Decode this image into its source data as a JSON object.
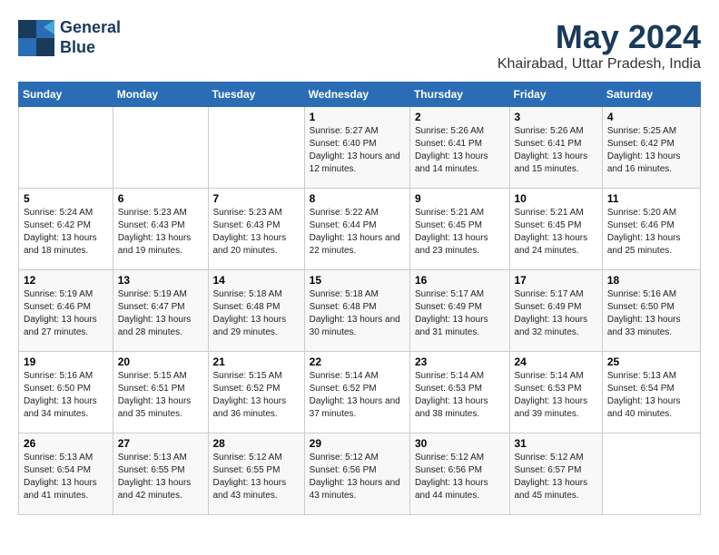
{
  "header": {
    "logo_line1": "General",
    "logo_line2": "Blue",
    "title": "May 2024",
    "subtitle": "Khairabad, Uttar Pradesh, India"
  },
  "weekdays": [
    "Sunday",
    "Monday",
    "Tuesday",
    "Wednesday",
    "Thursday",
    "Friday",
    "Saturday"
  ],
  "weeks": [
    [
      {
        "day": "",
        "sunrise": "",
        "sunset": "",
        "daylight": ""
      },
      {
        "day": "",
        "sunrise": "",
        "sunset": "",
        "daylight": ""
      },
      {
        "day": "",
        "sunrise": "",
        "sunset": "",
        "daylight": ""
      },
      {
        "day": "1",
        "sunrise": "Sunrise: 5:27 AM",
        "sunset": "Sunset: 6:40 PM",
        "daylight": "Daylight: 13 hours and 12 minutes."
      },
      {
        "day": "2",
        "sunrise": "Sunrise: 5:26 AM",
        "sunset": "Sunset: 6:41 PM",
        "daylight": "Daylight: 13 hours and 14 minutes."
      },
      {
        "day": "3",
        "sunrise": "Sunrise: 5:26 AM",
        "sunset": "Sunset: 6:41 PM",
        "daylight": "Daylight: 13 hours and 15 minutes."
      },
      {
        "day": "4",
        "sunrise": "Sunrise: 5:25 AM",
        "sunset": "Sunset: 6:42 PM",
        "daylight": "Daylight: 13 hours and 16 minutes."
      }
    ],
    [
      {
        "day": "5",
        "sunrise": "Sunrise: 5:24 AM",
        "sunset": "Sunset: 6:42 PM",
        "daylight": "Daylight: 13 hours and 18 minutes."
      },
      {
        "day": "6",
        "sunrise": "Sunrise: 5:23 AM",
        "sunset": "Sunset: 6:43 PM",
        "daylight": "Daylight: 13 hours and 19 minutes."
      },
      {
        "day": "7",
        "sunrise": "Sunrise: 5:23 AM",
        "sunset": "Sunset: 6:43 PM",
        "daylight": "Daylight: 13 hours and 20 minutes."
      },
      {
        "day": "8",
        "sunrise": "Sunrise: 5:22 AM",
        "sunset": "Sunset: 6:44 PM",
        "daylight": "Daylight: 13 hours and 22 minutes."
      },
      {
        "day": "9",
        "sunrise": "Sunrise: 5:21 AM",
        "sunset": "Sunset: 6:45 PM",
        "daylight": "Daylight: 13 hours and 23 minutes."
      },
      {
        "day": "10",
        "sunrise": "Sunrise: 5:21 AM",
        "sunset": "Sunset: 6:45 PM",
        "daylight": "Daylight: 13 hours and 24 minutes."
      },
      {
        "day": "11",
        "sunrise": "Sunrise: 5:20 AM",
        "sunset": "Sunset: 6:46 PM",
        "daylight": "Daylight: 13 hours and 25 minutes."
      }
    ],
    [
      {
        "day": "12",
        "sunrise": "Sunrise: 5:19 AM",
        "sunset": "Sunset: 6:46 PM",
        "daylight": "Daylight: 13 hours and 27 minutes."
      },
      {
        "day": "13",
        "sunrise": "Sunrise: 5:19 AM",
        "sunset": "Sunset: 6:47 PM",
        "daylight": "Daylight: 13 hours and 28 minutes."
      },
      {
        "day": "14",
        "sunrise": "Sunrise: 5:18 AM",
        "sunset": "Sunset: 6:48 PM",
        "daylight": "Daylight: 13 hours and 29 minutes."
      },
      {
        "day": "15",
        "sunrise": "Sunrise: 5:18 AM",
        "sunset": "Sunset: 6:48 PM",
        "daylight": "Daylight: 13 hours and 30 minutes."
      },
      {
        "day": "16",
        "sunrise": "Sunrise: 5:17 AM",
        "sunset": "Sunset: 6:49 PM",
        "daylight": "Daylight: 13 hours and 31 minutes."
      },
      {
        "day": "17",
        "sunrise": "Sunrise: 5:17 AM",
        "sunset": "Sunset: 6:49 PM",
        "daylight": "Daylight: 13 hours and 32 minutes."
      },
      {
        "day": "18",
        "sunrise": "Sunrise: 5:16 AM",
        "sunset": "Sunset: 6:50 PM",
        "daylight": "Daylight: 13 hours and 33 minutes."
      }
    ],
    [
      {
        "day": "19",
        "sunrise": "Sunrise: 5:16 AM",
        "sunset": "Sunset: 6:50 PM",
        "daylight": "Daylight: 13 hours and 34 minutes."
      },
      {
        "day": "20",
        "sunrise": "Sunrise: 5:15 AM",
        "sunset": "Sunset: 6:51 PM",
        "daylight": "Daylight: 13 hours and 35 minutes."
      },
      {
        "day": "21",
        "sunrise": "Sunrise: 5:15 AM",
        "sunset": "Sunset: 6:52 PM",
        "daylight": "Daylight: 13 hours and 36 minutes."
      },
      {
        "day": "22",
        "sunrise": "Sunrise: 5:14 AM",
        "sunset": "Sunset: 6:52 PM",
        "daylight": "Daylight: 13 hours and 37 minutes."
      },
      {
        "day": "23",
        "sunrise": "Sunrise: 5:14 AM",
        "sunset": "Sunset: 6:53 PM",
        "daylight": "Daylight: 13 hours and 38 minutes."
      },
      {
        "day": "24",
        "sunrise": "Sunrise: 5:14 AM",
        "sunset": "Sunset: 6:53 PM",
        "daylight": "Daylight: 13 hours and 39 minutes."
      },
      {
        "day": "25",
        "sunrise": "Sunrise: 5:13 AM",
        "sunset": "Sunset: 6:54 PM",
        "daylight": "Daylight: 13 hours and 40 minutes."
      }
    ],
    [
      {
        "day": "26",
        "sunrise": "Sunrise: 5:13 AM",
        "sunset": "Sunset: 6:54 PM",
        "daylight": "Daylight: 13 hours and 41 minutes."
      },
      {
        "day": "27",
        "sunrise": "Sunrise: 5:13 AM",
        "sunset": "Sunset: 6:55 PM",
        "daylight": "Daylight: 13 hours and 42 minutes."
      },
      {
        "day": "28",
        "sunrise": "Sunrise: 5:12 AM",
        "sunset": "Sunset: 6:55 PM",
        "daylight": "Daylight: 13 hours and 43 minutes."
      },
      {
        "day": "29",
        "sunrise": "Sunrise: 5:12 AM",
        "sunset": "Sunset: 6:56 PM",
        "daylight": "Daylight: 13 hours and 43 minutes."
      },
      {
        "day": "30",
        "sunrise": "Sunrise: 5:12 AM",
        "sunset": "Sunset: 6:56 PM",
        "daylight": "Daylight: 13 hours and 44 minutes."
      },
      {
        "day": "31",
        "sunrise": "Sunrise: 5:12 AM",
        "sunset": "Sunset: 6:57 PM",
        "daylight": "Daylight: 13 hours and 45 minutes."
      },
      {
        "day": "",
        "sunrise": "",
        "sunset": "",
        "daylight": ""
      }
    ]
  ]
}
